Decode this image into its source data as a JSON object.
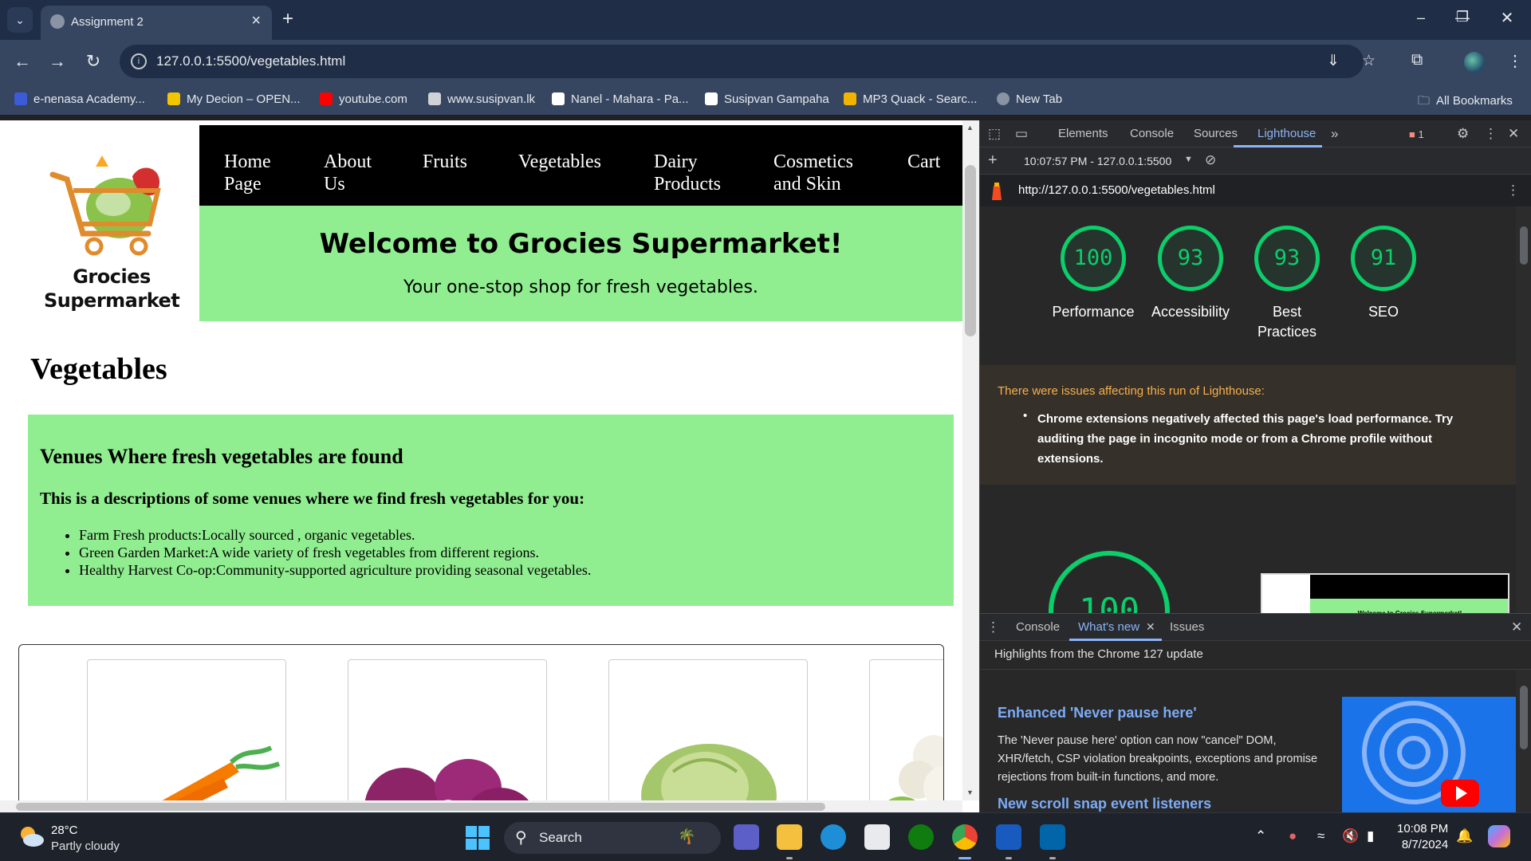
{
  "browser": {
    "tab_title": "Assignment 2",
    "url": "127.0.0.1:5500/vegetables.html",
    "bookmarks": [
      {
        "label": "e-nenasa Academy...",
        "color": "#3c5bd6"
      },
      {
        "label": "My Decion – OPEN...",
        "color": "#f2c500"
      },
      {
        "label": "youtube.com",
        "color": "#ff0000"
      },
      {
        "label": "www.susipvan.lk",
        "color": "#cfd2d6"
      },
      {
        "label": "Nanel - Mahara - Pa...",
        "color": "#ffffff"
      },
      {
        "label": "Susipvan Gampaha",
        "color": "#ffffff"
      },
      {
        "label": "MP3 Quack - Searc...",
        "color": "#f0b400"
      },
      {
        "label": "New Tab",
        "color": "#8a93a3"
      }
    ],
    "all_bookmarks": "All Bookmarks"
  },
  "site": {
    "logo_text_line1": "Grocies",
    "logo_text_line2": "Supermarket",
    "nav": [
      "Home Page",
      "About Us",
      "Fruits",
      "Vegetables",
      "Dairy Products",
      "Cosmetics and Skin care",
      "Cart"
    ],
    "hero_title": "Welcome to Grocies Supermarket!",
    "hero_subtitle": "Your one-stop shop for fresh vegetables.",
    "page_title": "Vegetables",
    "venues_title": "Venues Where fresh vegetables are found",
    "venues_desc": "This is a descriptions of some venues where we find fresh vegetables for you:",
    "venues": [
      "Farm Fresh products:Locally sourced , organic vegetables.",
      "Green Garden Market:A wide variety of fresh vegetables from different regions.",
      "Healthy Harvest Co-op:Community-supported agriculture providing seasonal vegetables."
    ],
    "products": [
      "carrot",
      "red onion",
      "cabbage",
      "cauliflower"
    ]
  },
  "devtools": {
    "tabs": [
      "Elements",
      "Console",
      "Sources",
      "Lighthouse"
    ],
    "active_tab": "Lighthouse",
    "issue_count": "1",
    "report_time": "10:07:57 PM - 127.0.0.1:5500",
    "report_url": "http://127.0.0.1:5500/vegetables.html",
    "scores": [
      {
        "value": "100",
        "label": "Performance"
      },
      {
        "value": "93",
        "label": "Accessibility"
      },
      {
        "value": "93",
        "label": "Best Practices"
      },
      {
        "value": "91",
        "label": "SEO"
      }
    ],
    "warning_head": "There were issues affecting this run of Lighthouse:",
    "warning_body": "Chrome extensions negatively affected this page's load performance. Try auditing the page in incognito mode or from a Chrome profile without extensions.",
    "big_score": "100",
    "thumb_title": "Welcome to Grocies Supermarket!",
    "drawer_tabs": [
      "Console",
      "What's new",
      "Issues"
    ],
    "drawer_active": "What's new",
    "whatsnew_subtitle": "Highlights from the Chrome 127 update",
    "whatsnew_h1": "Enhanced 'Never pause here'",
    "whatsnew_p1": "The 'Never pause here' option can now \"cancel\" DOM, XHR/fetch, CSP violation breakpoints, exceptions and promise rejections from built-in functions, and more.",
    "whatsnew_h2": "New scroll snap event listeners",
    "accent": "#8ab4f8",
    "score_color": "#0cce6b"
  },
  "taskbar": {
    "temp": "28°C",
    "weather": "Partly cloudy",
    "search": "Search",
    "time": "10:08 PM",
    "date": "8/7/2024"
  }
}
